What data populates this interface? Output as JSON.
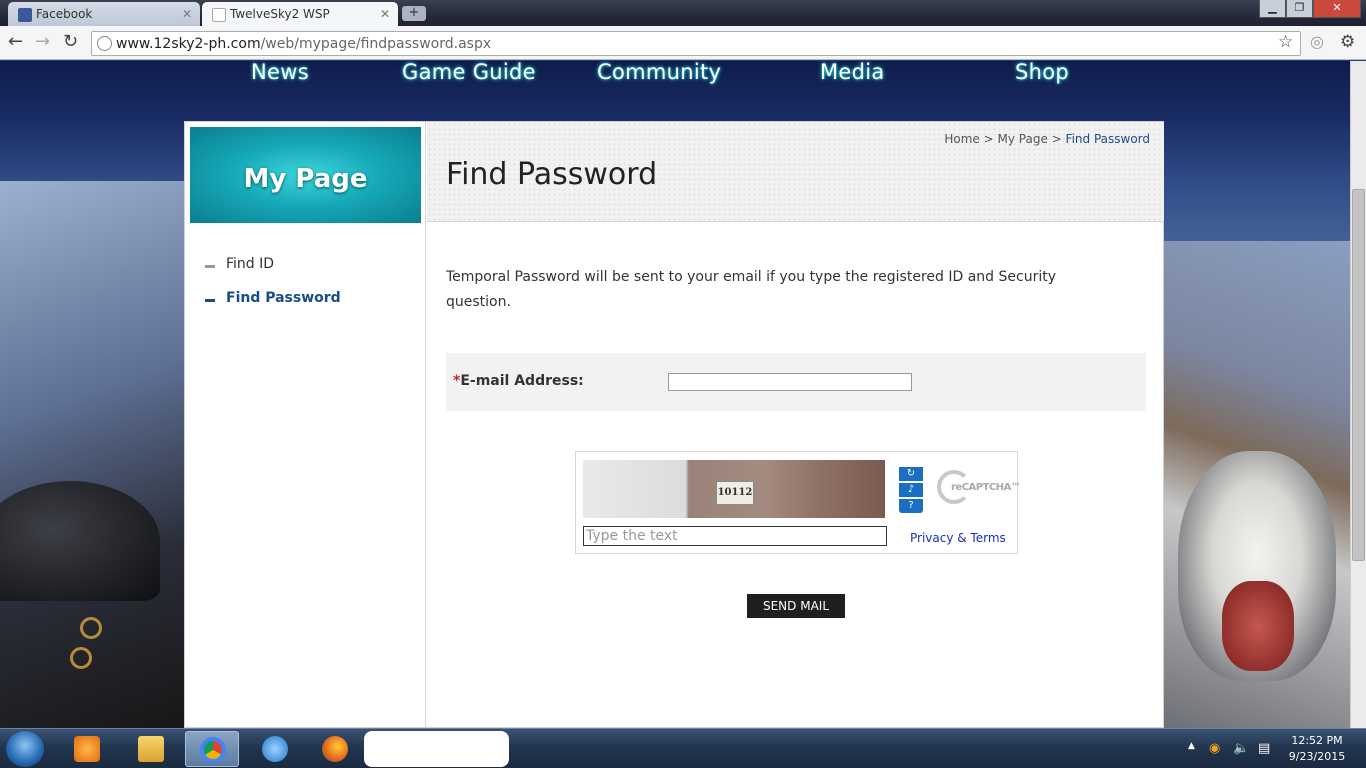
{
  "browser": {
    "tabs": [
      {
        "title": "Facebook",
        "active": false,
        "favicon_color": "#3b5998"
      },
      {
        "title": "TwelveSky2 WSP",
        "active": true,
        "favicon_color": "#ffffff"
      }
    ],
    "address": {
      "host": "www.12sky2-ph.com",
      "path": "/web/mypage/findpassword.aspx"
    }
  },
  "site_nav": [
    {
      "label": "News"
    },
    {
      "label": "Game Guide"
    },
    {
      "label": "Community"
    },
    {
      "label": "Media"
    },
    {
      "label": "Shop"
    }
  ],
  "sidebar": {
    "banner": "My Page",
    "items": [
      {
        "label": "Find ID",
        "active": false
      },
      {
        "label": "Find Password",
        "active": true
      }
    ]
  },
  "breadcrumb": {
    "home": "Home",
    "sep1": ">",
    "mypage": "My Page",
    "sep2": ">",
    "current": "Find Password"
  },
  "main": {
    "title": "Find Password",
    "intro": "Temporal Password will be sent to your email if you type the registered ID and Security question.",
    "email_required_mark": "*",
    "email_label": "E-mail Address:",
    "email_value": ""
  },
  "captcha": {
    "image_text": "10112",
    "input_placeholder": "Type the text",
    "logo_text": "reCAPTCHA™",
    "privacy_link": "Privacy & Terms",
    "buttons": [
      "refresh-icon",
      "audio-icon",
      "help-icon"
    ]
  },
  "send_button": "SEND MAIL",
  "taskbar": {
    "time": "12:52 PM",
    "date": "9/23/2015"
  },
  "colors": {
    "accent": "#1a4c8a",
    "banner": "#16a9b8",
    "required": "#cc2222",
    "button": "#1f1f1f"
  }
}
